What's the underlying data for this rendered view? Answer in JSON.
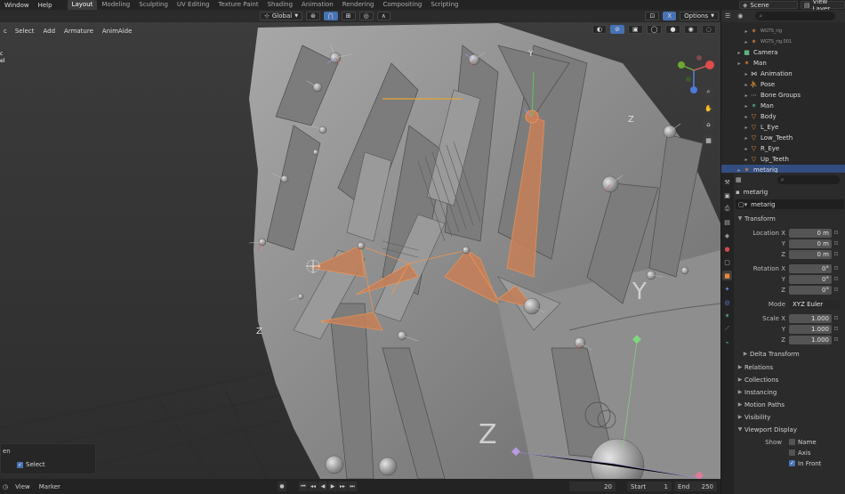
{
  "topbar": {
    "menus": [
      "Window",
      "Help"
    ],
    "workspaces": [
      "Layout",
      "Modeling",
      "Sculpting",
      "UV Editing",
      "Texture Paint",
      "Shading",
      "Animation",
      "Rendering",
      "Compositing",
      "Scripting"
    ],
    "active_workspace": "Layout",
    "scene_label": "Scene",
    "view_layer_label": "View Layer"
  },
  "viewport": {
    "header_menus": [
      "Select",
      "Add",
      "Armature",
      "AnimAide"
    ],
    "left_info_lines": [
      "c",
      "el"
    ],
    "transform_orientation": "Global",
    "options_label": "Options",
    "axis_letters": {
      "y": "Y",
      "z": "Z"
    },
    "operator_panel": {
      "title": "en",
      "select_label": "Select",
      "select_checked": true
    }
  },
  "timeline": {
    "menus": [
      "View",
      "Marker"
    ],
    "current_frame": "20",
    "start_label": "Start",
    "start_value": "1",
    "end_label": "End",
    "end_value": "250"
  },
  "outliner": {
    "rows": [
      {
        "label": "WGTS_rig",
        "icon": "armature-icon",
        "indent": 3,
        "tiny": true
      },
      {
        "label": "WGTS_rig.001",
        "icon": "armature-icon",
        "indent": 3,
        "tiny": true
      },
      {
        "label": "Camera",
        "icon": "camera-icon",
        "indent": 2
      },
      {
        "label": "Man",
        "icon": "armature-icon",
        "indent": 2
      },
      {
        "label": "Animation",
        "icon": "animation-icon",
        "indent": 3
      },
      {
        "label": "Pose",
        "icon": "pose-icon",
        "indent": 3
      },
      {
        "label": "Bone Groups",
        "icon": "bone-groups-icon",
        "indent": 3
      },
      {
        "label": "Man",
        "icon": "armature-data-icon",
        "indent": 3
      },
      {
        "label": "Body",
        "icon": "mesh-icon",
        "indent": 3
      },
      {
        "label": "L_Eye",
        "icon": "mesh-icon",
        "indent": 3
      },
      {
        "label": "Low_Teeth",
        "icon": "mesh-icon",
        "indent": 3
      },
      {
        "label": "R_Eye",
        "icon": "mesh-icon",
        "indent": 3
      },
      {
        "label": "Up_Teeth",
        "icon": "mesh-icon",
        "indent": 3
      },
      {
        "label": "metarig",
        "icon": "armature-icon",
        "indent": 2,
        "selected": true
      }
    ]
  },
  "properties": {
    "object_title": "metarig",
    "name_field": "metarig",
    "transform_section": "Transform",
    "location": {
      "label": "Location X",
      "x": "0 m",
      "y": "0 m",
      "z": "0 m"
    },
    "rotation": {
      "label": "Rotation X",
      "x": "0°",
      "y": "0°",
      "z": "0°"
    },
    "mode": {
      "label": "Mode",
      "value": "XYZ Euler"
    },
    "scale": {
      "label": "Scale X",
      "x": "1.000",
      "y": "1.000",
      "z": "1.000"
    },
    "axis_labels": {
      "y": "Y",
      "z": "Z"
    },
    "delta_transform": "Delta Transform",
    "sections": [
      "Relations",
      "Collections",
      "Instancing",
      "Motion Paths",
      "Visibility",
      "Viewport Display"
    ],
    "viewport_display": {
      "show_label": "Show",
      "name_label": "Name",
      "axis_label": "Axis",
      "in_front_label": "In Front",
      "in_front_checked": true
    }
  },
  "colors": {
    "accent": "#4772b3",
    "orange": "#e8883a",
    "green": "#5fb586",
    "selection": "#334d80"
  }
}
